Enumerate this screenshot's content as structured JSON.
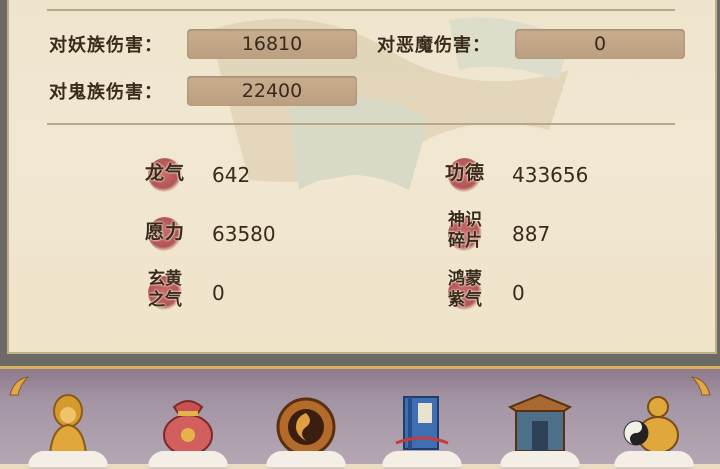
{
  "damage": {
    "demon_label": "对妖族伤害：",
    "demon_value": "16810",
    "evil_label": "对恶魔伤害：",
    "evil_value": "0",
    "ghost_label": "对鬼族伤害：",
    "ghost_value": "22400"
  },
  "stats": [
    {
      "label": "龙气",
      "value": "642",
      "icon": "dragon-qi-icon"
    },
    {
      "label": "功德",
      "value": "433656",
      "icon": "merit-icon"
    },
    {
      "label": "愿力",
      "value": "63580",
      "icon": "wish-power-icon"
    },
    {
      "label": "神识碎片",
      "value": "887",
      "icon": "divine-sense-fragment-icon"
    },
    {
      "label": "玄黄之气",
      "value": "0",
      "icon": "xuanhuang-qi-icon"
    },
    {
      "label": "鸿蒙紫气",
      "value": "0",
      "icon": "hongmeng-purple-qi-icon"
    }
  ],
  "bottom_bar": {
    "items": [
      {
        "icon": "golden-monk-icon"
      },
      {
        "icon": "treasure-bag-icon"
      },
      {
        "icon": "bronze-talisman-icon"
      },
      {
        "icon": "blue-book-icon"
      },
      {
        "icon": "shrine-gate-icon"
      },
      {
        "icon": "gourd-taiji-icon"
      }
    ]
  },
  "colors": {
    "parchment": "#f2e8d2",
    "value_box": "#c2a688",
    "text_dark": "#3a2a1c",
    "icon_blob": "#b25555",
    "bar_bg": "#a495a4",
    "bar_trim": "#d8b35a"
  }
}
